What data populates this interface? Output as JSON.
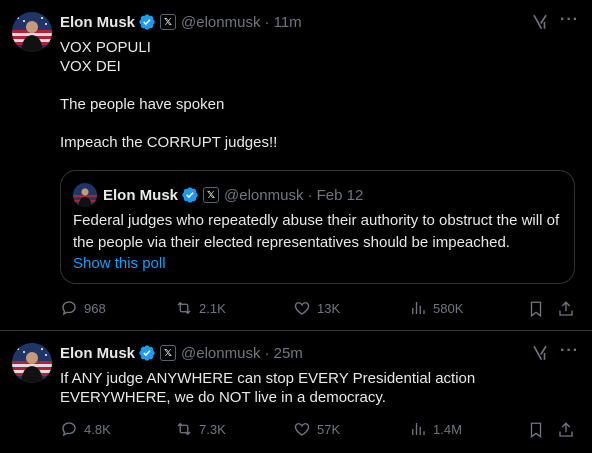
{
  "tweets": [
    {
      "author": "Elon Musk",
      "x_badge": "𝕏",
      "handle": "@elonmusk",
      "time": "· 11m",
      "text": "VOX POPULI\nVOX DEI\n\nThe people have spoken\n\nImpeach the CORRUPT judges!!",
      "quote": {
        "author": "Elon Musk",
        "x_badge": "𝕏",
        "handle": "@elonmusk",
        "time": "· Feb 12",
        "text": "Federal judges who repeatedly abuse their authority to obstruct the will of the people via their elected representatives should be impeached.",
        "link": "Show this poll"
      },
      "stats": {
        "replies": "968",
        "reposts": "2.1K",
        "likes": "13K",
        "views": "580K"
      }
    },
    {
      "author": "Elon Musk",
      "x_badge": "𝕏",
      "handle": "@elonmusk",
      "time": "· 25m",
      "text": "If ANY judge ANYWHERE can stop EVERY Presidential action EVERYWHERE, we do NOT live in a democracy.",
      "stats": {
        "replies": "4.8K",
        "reposts": "7.3K",
        "likes": "57K",
        "views": "1.4M"
      }
    }
  ],
  "more_label": "···",
  "colors": {
    "background": "#000000",
    "text": "#e7e9ea",
    "muted": "#71767b",
    "link": "#1d9bf0",
    "verified": "#1d9bf0",
    "border": "#2f3336"
  }
}
